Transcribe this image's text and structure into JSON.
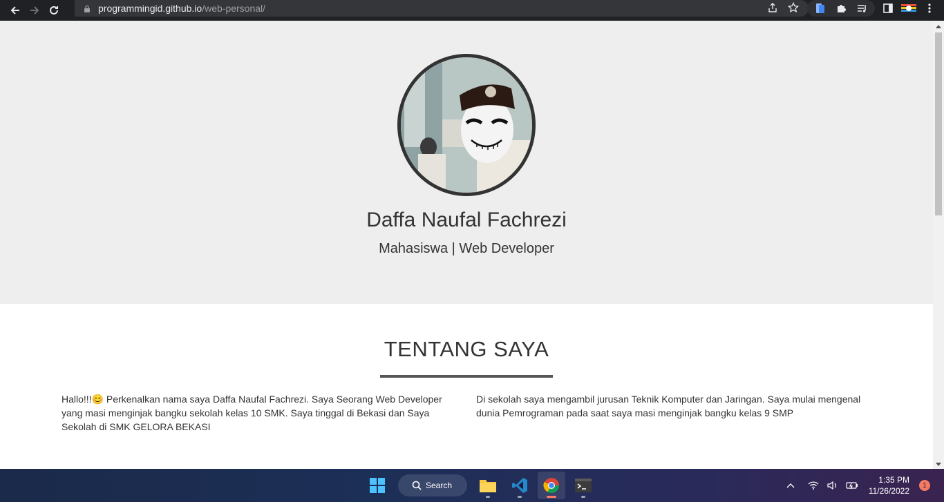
{
  "browser": {
    "url_host": "programmingid.github.io",
    "url_path": "/web-personal/"
  },
  "hero": {
    "name": "Daffa Naufal Fachrezi",
    "role": "Mahasiswa | Web Developer"
  },
  "about": {
    "title": "TENTANG SAYA",
    "left_text": "Hallo!!!😊 Perkenalkan nama saya Daffa Naufal Fachrezi. Saya Seorang Web Developer yang masi menginjak bangku sekolah kelas 10 SMK. Saya tinggal di Bekasi dan Saya Sekolah di SMK GELORA BEKASI",
    "right_text": "Di sekolah saya mengambil jurusan Teknik Komputer dan Jaringan. Saya mulai mengenal dunia Pemrograman pada saat saya masi menginjak bangku kelas 9 SMP"
  },
  "taskbar": {
    "search_label": "Search",
    "time": "1:35 PM",
    "date": "11/26/2022",
    "notification_count": "1"
  },
  "colors": {
    "hero_bg": "#eeeeee",
    "text": "#333333",
    "chrome_bg": "#202124"
  }
}
